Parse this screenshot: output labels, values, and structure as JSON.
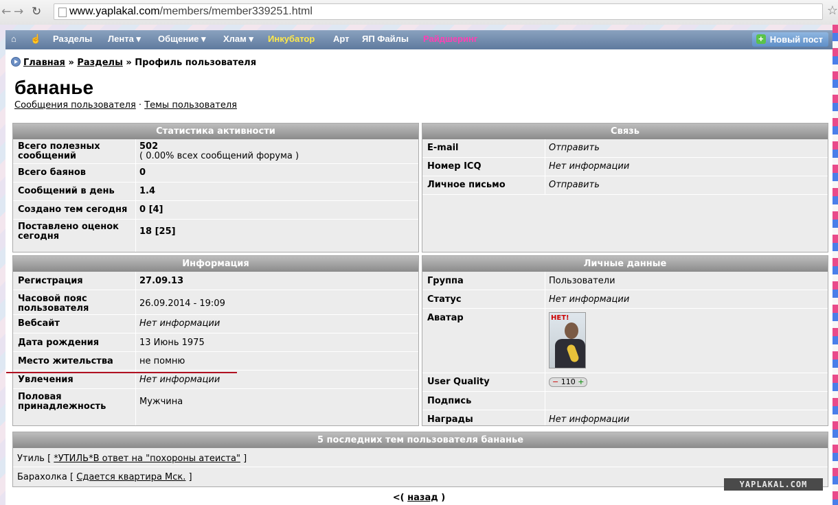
{
  "browser": {
    "url_host": "www.yaplakal.com",
    "url_path": "/members/member339251.html"
  },
  "menu": {
    "items": [
      {
        "label": "Разделы"
      },
      {
        "label": "Лента ▾"
      },
      {
        "label": "Общение ▾"
      },
      {
        "label": "Хлам ▾"
      },
      {
        "label": "Инкубатор"
      },
      {
        "label": "Арт"
      },
      {
        "label": "ЯП Файлы"
      },
      {
        "label": "Райдшеринг"
      }
    ],
    "new_post": "Новый пост"
  },
  "breadcrumb": {
    "home": "Главная",
    "sep": "»",
    "sections": "Разделы",
    "current": "Профиль пользователя"
  },
  "profile": {
    "name": "бананье",
    "link_posts": "Сообщения пользователя",
    "link_sep": "·",
    "link_topics": "Темы пользователя"
  },
  "stats": {
    "title": "Статистика активности",
    "rows": [
      {
        "label": "Всего полезных сообщений",
        "value": "502",
        "note": "( 0.00% всех сообщений форума )"
      },
      {
        "label": "Всего баянов",
        "value": "0"
      },
      {
        "label": "Сообщений в день",
        "value": "1.4"
      },
      {
        "label": "Создано тем сегодня",
        "value": "0 [4]"
      },
      {
        "label": "Поставлено оценок сегодня",
        "value": "18 [25]"
      }
    ]
  },
  "contact": {
    "title": "Связь",
    "rows": [
      {
        "label": "E-mail",
        "value": "Отправить"
      },
      {
        "label": "Номер ICQ",
        "value": "Нет информации"
      },
      {
        "label": "Личное письмо",
        "value": "Отправить"
      }
    ]
  },
  "info": {
    "title": "Информация",
    "rows": [
      {
        "label": "Регистрация",
        "value": "27.09.13"
      },
      {
        "label": "Часовой пояс пользователя",
        "value": "26.09.2014 - 19:09"
      },
      {
        "label": "Вебсайт",
        "value": "Нет информации"
      },
      {
        "label": "Дата рождения",
        "value": "13 Июнь 1975"
      },
      {
        "label": "Место жительства",
        "value": "не помню"
      },
      {
        "label": "Увлечения",
        "value": "Нет информации"
      },
      {
        "label": "Половая принадлежность",
        "value": "Мужчина"
      }
    ]
  },
  "personal": {
    "title": "Личные данные",
    "rows": [
      {
        "label": "Группа",
        "value": "Пользователи"
      },
      {
        "label": "Статус",
        "value": "Нет информации"
      },
      {
        "label": "Аватар",
        "avatar_text": "НЕТ!"
      },
      {
        "label": "User Quality",
        "minus": "−",
        "value": "110",
        "plus": "+"
      },
      {
        "label": "Подпись",
        "value": ""
      },
      {
        "label": "Награды",
        "value": "Нет информации"
      }
    ]
  },
  "topics": {
    "title": "5 последних тем пользователя бананье",
    "items": [
      {
        "section": "Утиль",
        "open": "[",
        "link": "*УТИЛЬ*В ответ на \"похороны атеиста\"",
        "close": "]"
      },
      {
        "section": "Барахолка",
        "open": "[",
        "link": "Сдается квартира Мск.",
        "close": "]"
      }
    ]
  },
  "back": {
    "open": "<(",
    "link": "назад",
    "close": ")"
  },
  "watermark": "YAPLAKAL.COM",
  "colors": {
    "menu": "#6f88aa",
    "incubator": "#ffe94a",
    "rideshare": "#ff3fb4",
    "header": "#9b9b9b",
    "underline": "#b01020"
  }
}
